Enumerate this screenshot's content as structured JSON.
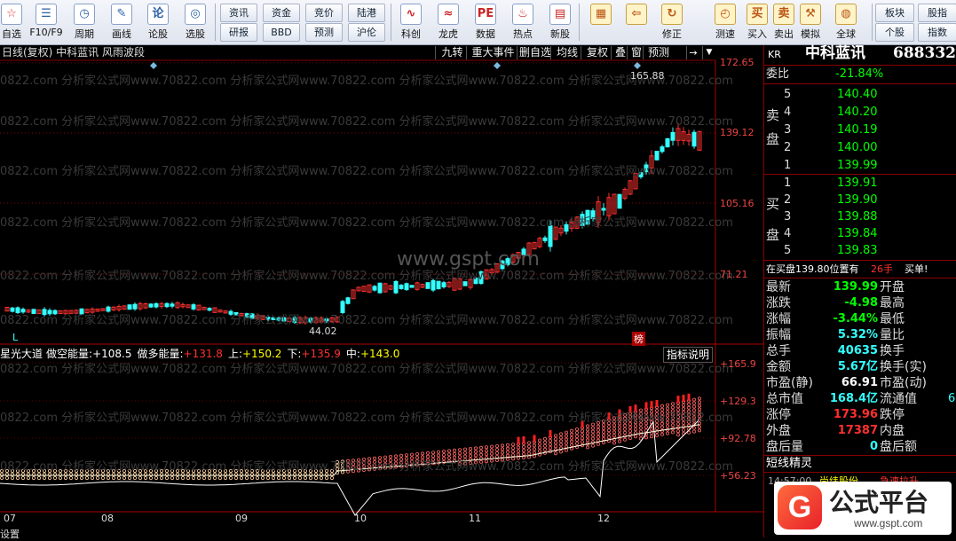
{
  "toolbar": {
    "left_items": [
      {
        "label": "自选",
        "icon": "star-list-icon",
        "color": "#d33"
      },
      {
        "label": "F10/F9",
        "icon": "f10-icon",
        "color": "#2a5fa8"
      },
      {
        "label": "周期",
        "icon": "clock-icon",
        "color": "#2a5fa8"
      },
      {
        "label": "画线",
        "icon": "pencil-icon",
        "color": "#2a5fa8"
      },
      {
        "label": "论股",
        "icon": "discuss-icon",
        "color": "#2a5fa8"
      },
      {
        "label": "选股",
        "icon": "select-stock-icon",
        "color": "#2a5fa8"
      }
    ],
    "grid_buttons": [
      [
        "资讯",
        "资金",
        "竞价",
        "陆港"
      ],
      [
        "研报",
        "BBD",
        "预测",
        "沪伦"
      ]
    ],
    "mid_items": [
      {
        "label": "科创",
        "icon": "kechuang-icon"
      },
      {
        "label": "龙虎",
        "icon": "dragon-tiger-icon"
      },
      {
        "label": "数据",
        "icon": "pe-data-icon"
      },
      {
        "label": "热点",
        "icon": "hot-icon"
      },
      {
        "label": "新股",
        "icon": "ipo-icon"
      }
    ],
    "right_items": [
      {
        "label": "",
        "icon": "color-blocks-icon"
      },
      {
        "label": "",
        "icon": "back-arrow-icon"
      },
      {
        "label": "修正",
        "icon": "correct-icon"
      },
      {
        "label": "测速",
        "icon": "speed-test-icon"
      },
      {
        "label": "买入",
        "icon": "buy-icon"
      },
      {
        "label": "卖出",
        "icon": "sell-icon"
      },
      {
        "label": "模拟",
        "icon": "simulate-icon"
      },
      {
        "label": "全球",
        "icon": "globe-icon"
      }
    ],
    "far_right": [
      [
        "板块",
        "股指"
      ],
      [
        "个股",
        "指数"
      ]
    ]
  },
  "chart": {
    "title": "日线(复权) 中科蓝讯 风雨波段",
    "menu": [
      "九转",
      "重大事件",
      "删自选",
      "均线",
      "复权",
      "叠",
      "窗",
      "预测"
    ],
    "price_axis": [
      "172.65",
      "139.12",
      "105.16",
      "71.21"
    ],
    "high_label": "165.88",
    "low_label": "44.02",
    "watermark_center": "www.gspt.com",
    "watermark_row": "0822.com 分析家公式网www.70822.com 分析家公式网www.70822.com 分析家公式网www.70822.com 分析家公式网www.70822.com",
    "ind_badge": "榜",
    "l_marker": "L"
  },
  "indicator": {
    "label": "星光大道",
    "values": [
      {
        "name": "做空能量:",
        "value": "+108.5",
        "color": "#fff"
      },
      {
        "name": "做多能量:",
        "value": "+131.8",
        "color": "#ff3030"
      },
      {
        "name": "上:",
        "value": "+150.2",
        "color": "#ffff00"
      },
      {
        "name": "下:",
        "value": "+135.9",
        "color": "#ff3030"
      },
      {
        "name": "中:",
        "value": "+143.0",
        "color": "#ffff00"
      }
    ],
    "explain_button": "指标说明",
    "axis": [
      "+165.9",
      "+129.3",
      "+92.78",
      "+56.23"
    ]
  },
  "months": [
    "07",
    "08",
    "09",
    "10",
    "11",
    "12"
  ],
  "quote": {
    "code_prefix": "KR",
    "name": "中科蓝讯",
    "code": "688332",
    "weibi_label": "委比",
    "weibi": "-21.84%",
    "sell": [
      {
        "lvl": "5",
        "price": "140.40"
      },
      {
        "lvl": "4",
        "price": "140.20"
      },
      {
        "lvl": "3",
        "price": "140.19"
      },
      {
        "lvl": "2",
        "price": "140.00"
      },
      {
        "lvl": "1",
        "price": "139.99"
      }
    ],
    "sell_label": [
      "卖",
      "盘"
    ],
    "buy": [
      {
        "lvl": "1",
        "price": "139.91"
      },
      {
        "lvl": "2",
        "price": "139.90"
      },
      {
        "lvl": "3",
        "price": "139.88"
      },
      {
        "lvl": "4",
        "price": "139.84"
      },
      {
        "lvl": "5",
        "price": "139.83"
      }
    ],
    "buy_label": [
      "买",
      "盘"
    ],
    "position_text": "在买盘139.80位置有",
    "position_qty": "26手",
    "position_note": "买单!",
    "stats": [
      {
        "l1": "最新",
        "v1": "139.99",
        "c1": "#00ff00",
        "l2": "开盘",
        "v2": ""
      },
      {
        "l1": "涨跌",
        "v1": "-4.98",
        "c1": "#00ff00",
        "l2": "最高",
        "v2": ""
      },
      {
        "l1": "涨幅",
        "v1": "-3.44%",
        "c1": "#00ff00",
        "l2": "最低",
        "v2": ""
      },
      {
        "l1": "振幅",
        "v1": "5.32%",
        "c1": "#33ffff",
        "l2": "量比",
        "v2": ""
      },
      {
        "l1": "总手",
        "v1": "40635",
        "c1": "#33ffff",
        "l2": "换手",
        "v2": ""
      },
      {
        "l1": "金额",
        "v1": "5.67亿",
        "c1": "#33ffff",
        "l2": "换手(实)",
        "v2": ""
      },
      {
        "l1": "市盈(静)",
        "v1": "66.91",
        "c1": "#ffffff",
        "l2": "市盈(动)",
        "v2": ""
      },
      {
        "l1": "总市值",
        "v1": "168.4亿",
        "c1": "#33ffff",
        "l2": "流通值",
        "v2": "6"
      },
      {
        "l1": "涨停",
        "v1": "173.96",
        "c1": "#ff3030",
        "l2": "跌停",
        "v2": ""
      },
      {
        "l1": "外盘",
        "v1": "17387",
        "c1": "#ff3030",
        "l2": "内盘",
        "v2": ""
      },
      {
        "l1": "盘后量",
        "v1": "0",
        "c1": "#33ffff",
        "l2": "盘后额",
        "v2": ""
      }
    ],
    "short_title": "短线精灵",
    "short_time": "14:57:00",
    "short_name": "尚纬股份",
    "short_event": "急速拉升"
  },
  "logo": {
    "text": "公式平台",
    "url": "www.gspt.com"
  },
  "status_bar": "设置"
}
